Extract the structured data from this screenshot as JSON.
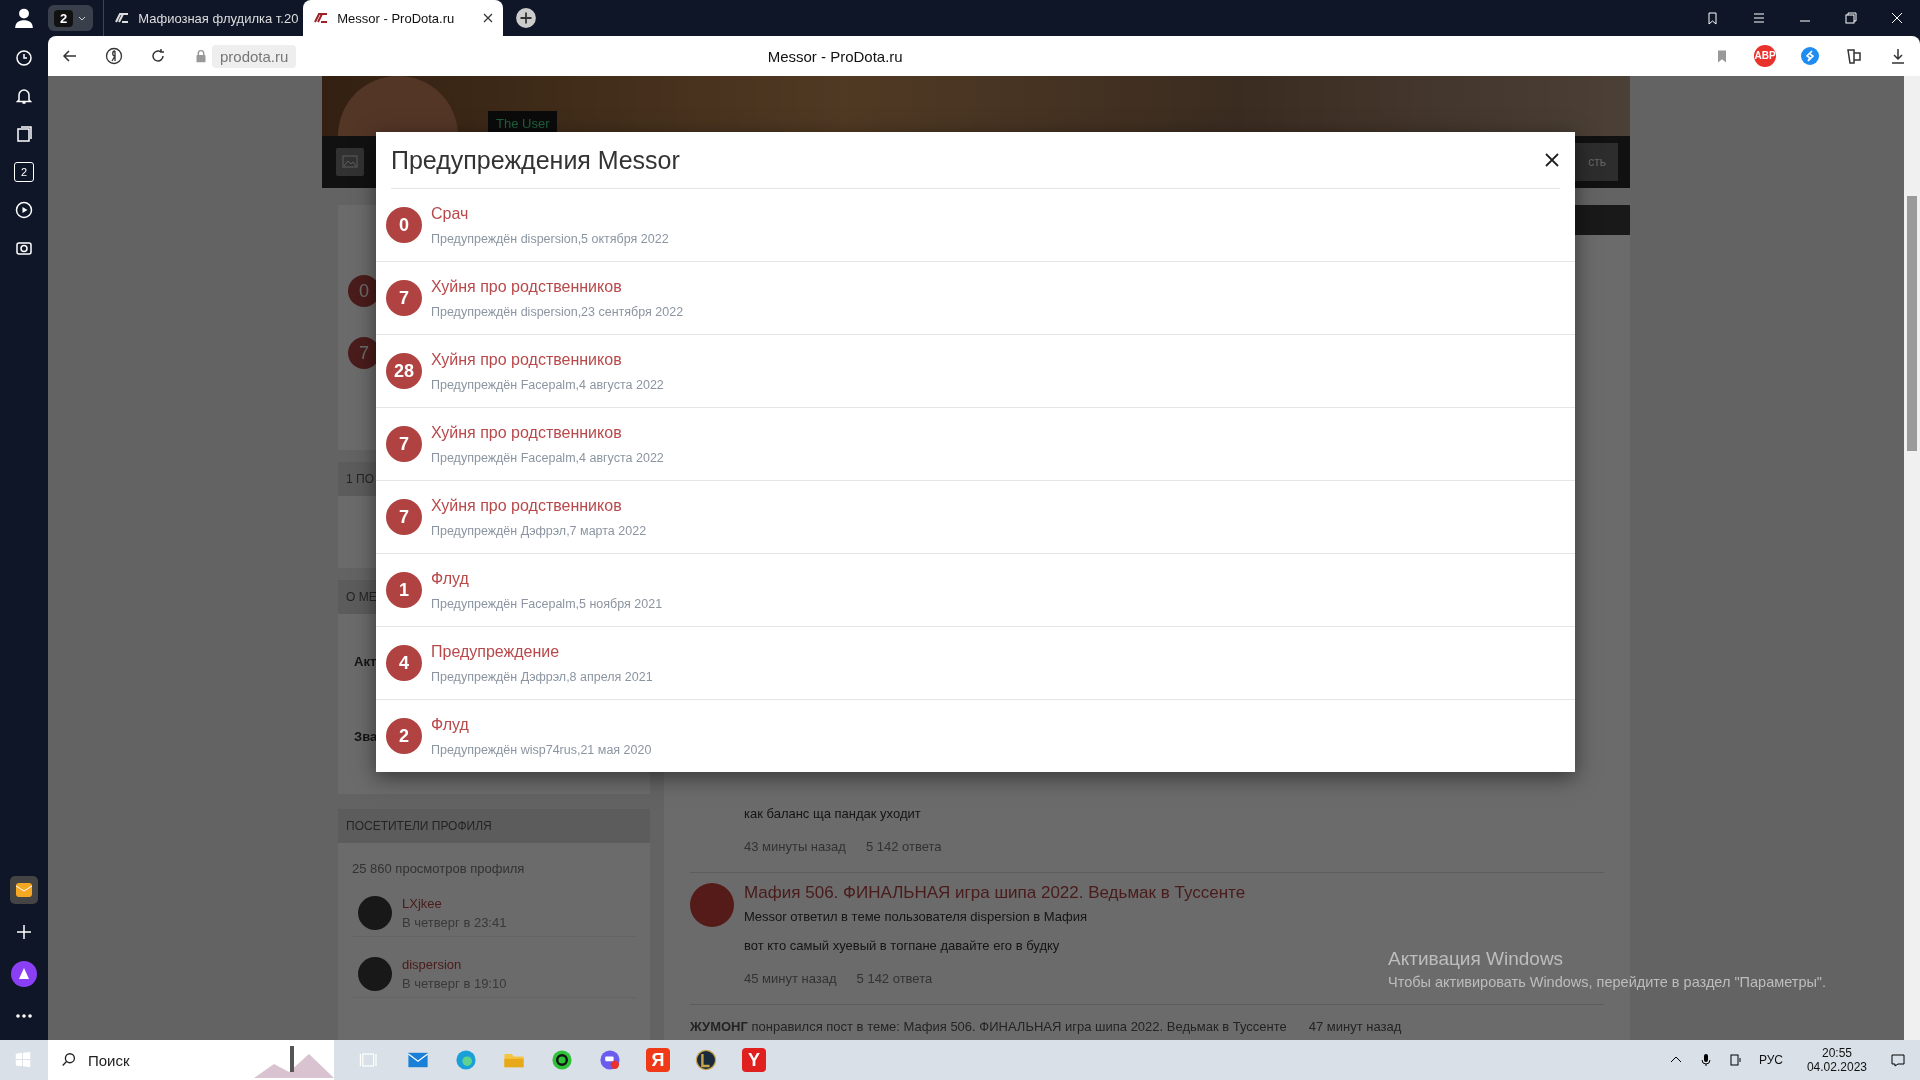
{
  "browser": {
    "tab_group_count": "2",
    "tabs": [
      {
        "title": "Мафиозная флудилка т.20",
        "selected": false
      },
      {
        "title": "Messor - ProDota.ru",
        "selected": true
      }
    ],
    "address": "prodota.ru",
    "page_title": "Messor - ProDota.ru",
    "extension_label": "ABP",
    "sidebar_badge": "2"
  },
  "profile": {
    "rank": "The User",
    "button_partial": "сть"
  },
  "left_column": {
    "warning_badges": [
      "0",
      "7"
    ],
    "headings": [
      "1 ПО",
      "О МЕ"
    ],
    "labels": [
      "Акт",
      "Зва"
    ],
    "visitors": {
      "title": "ПОСЕТИТЕЛИ ПРОФИЛЯ",
      "views": "25 860 просмотров профиля",
      "items": [
        {
          "name": "LXjkee",
          "time": "В четверг в 23:41"
        },
        {
          "name": "dispersion",
          "time": "В четверг в 19:10"
        }
      ]
    }
  },
  "activity": {
    "posts": [
      {
        "text": "как баланс ща пандак уходит",
        "time": "43 минуты назад",
        "replies": "5 142 ответа"
      },
      {
        "title": "Мафия 506. ФИНАЛЬНАЯ игра шипа 2022. Ведьмак в Туссенте",
        "summary": "Messor ответил в теме пользователя dispersion в Мафия",
        "text": "вот кто самый хуевый в тогпане давайте его в будку",
        "time": "45 минут назад",
        "replies": "5 142 ответа"
      }
    ],
    "like_line": "**ЖУМОНГ** понравился пост в теме: Мафия 506. ФИНАЛЬНАЯ игра шипа 2022. Ведьмак в Туссенте",
    "like_time": "47 минут назад"
  },
  "modal": {
    "title": "Предупреждения Messor",
    "warnings": [
      {
        "points": "0",
        "reason": "Срач",
        "meta": "Предупреждён dispersion,5 октября 2022"
      },
      {
        "points": "7",
        "reason": "Хуйня про родственников",
        "meta": "Предупреждён dispersion,23 сентября 2022"
      },
      {
        "points": "28",
        "reason": "Хуйня про родственников",
        "meta": "Предупреждён Facepalm,4 августа 2022"
      },
      {
        "points": "7",
        "reason": "Хуйня про родственников",
        "meta": "Предупреждён Facepalm,4 августа 2022"
      },
      {
        "points": "7",
        "reason": "Хуйня про родственников",
        "meta": "Предупреждён Дэфрэл,7 марта 2022"
      },
      {
        "points": "1",
        "reason": "Флуд",
        "meta": "Предупреждён Facepalm,5 ноября 2021"
      },
      {
        "points": "4",
        "reason": "Предупреждение",
        "meta": "Предупреждён Дэфрэл,8 апреля 2021"
      },
      {
        "points": "2",
        "reason": "Флуд",
        "meta": "Предупреждён wisp74rus,21 мая 2020"
      }
    ]
  },
  "windows_notice": {
    "title": "Активация Windows",
    "text": "Чтобы активировать Windows, перейдите в раздел \"Параметры\"."
  },
  "taskbar": {
    "search_placeholder": "Поиск",
    "language": "РУС",
    "time": "20:55",
    "date": "04.02.2023",
    "apps": [
      {
        "kind": "taskview"
      },
      {
        "kind": "mail"
      },
      {
        "kind": "globe"
      },
      {
        "kind": "folder"
      },
      {
        "kind": "ring"
      },
      {
        "kind": "chat"
      },
      {
        "kind": "letter",
        "glyph": "Я",
        "color": "#f03a17"
      },
      {
        "kind": "helmet"
      },
      {
        "kind": "letter",
        "glyph": "Y",
        "color": "#e01f1f"
      }
    ]
  }
}
